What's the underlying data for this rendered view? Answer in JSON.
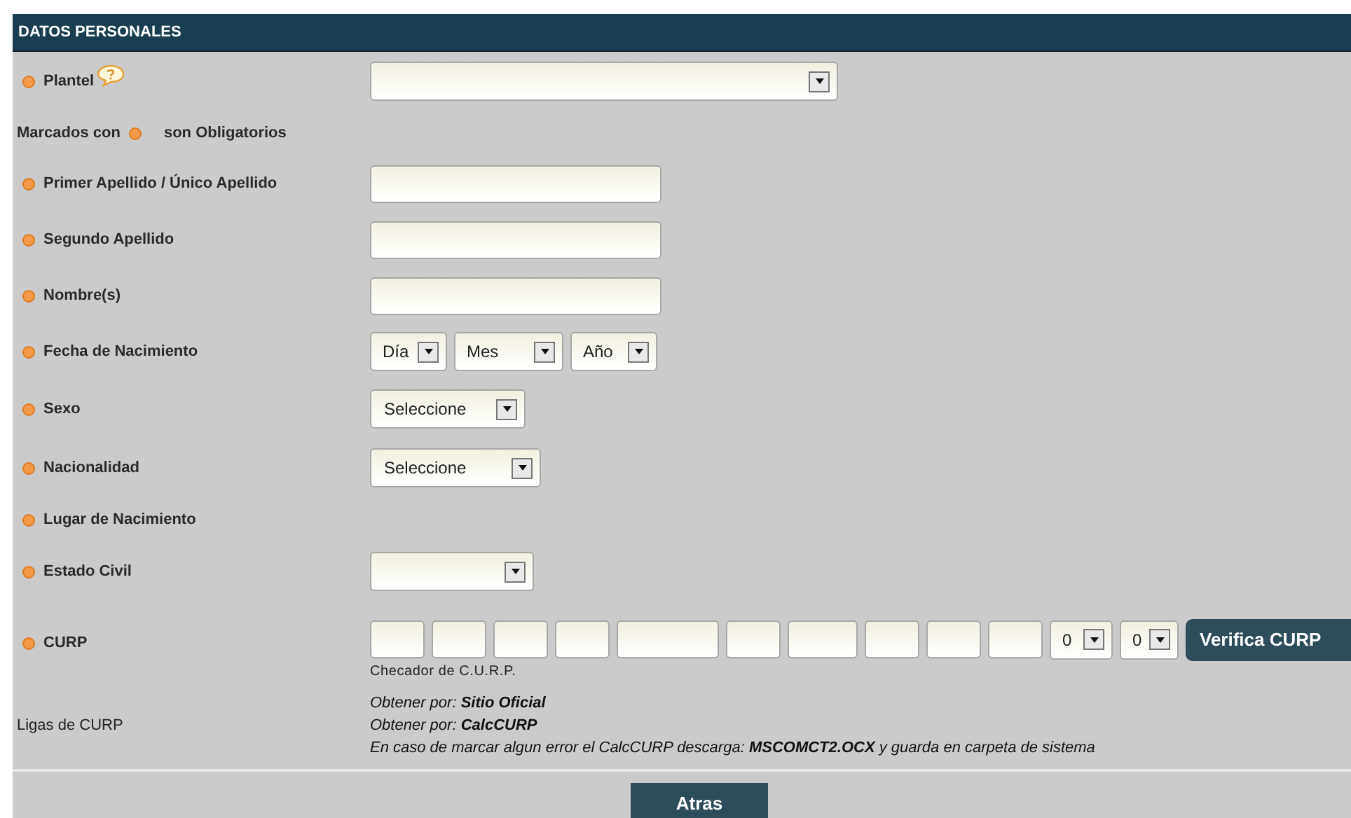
{
  "section_title": "DATOS PERSONALES",
  "rows": [
    {
      "kind": "select",
      "label": "Plantel",
      "required": true,
      "help": true,
      "value": ""
    },
    {
      "kind": "note",
      "before": "Marcados con",
      "after": "son Obligatorios"
    },
    {
      "kind": "text",
      "label": "Primer Apellido / Único Apellido",
      "required": true
    },
    {
      "kind": "text",
      "label": "Segundo Apellido",
      "required": true
    },
    {
      "kind": "text",
      "label": "Nombre(s)",
      "required": true
    },
    {
      "kind": "date",
      "label": "Fecha de Nacimiento",
      "required": true,
      "selects": [
        {
          "kind": "day",
          "value": "Día"
        },
        {
          "kind": "month",
          "value": "Mes"
        },
        {
          "kind": "year",
          "value": "Año"
        }
      ]
    },
    {
      "kind": "select",
      "label": "Sexo",
      "required": true,
      "value": "Seleccione"
    },
    {
      "kind": "select",
      "label": "Nacionalidad",
      "required": true,
      "value": "Seleccione"
    },
    {
      "kind": "none",
      "label": "Lugar de Nacimiento",
      "required": true
    },
    {
      "kind": "select",
      "label": "Estado Civil",
      "required": true,
      "value": ""
    },
    {
      "kind": "curp",
      "label": "CURP",
      "required": true,
      "caption": "Checador de C.U.R.P.",
      "button": "Verifica CURP",
      "segments": [
        {
          "kind": "short"
        },
        {
          "kind": "short"
        },
        {
          "kind": "short"
        },
        {
          "kind": "short"
        },
        {
          "kind": "wide"
        },
        {
          "kind": "short"
        },
        {
          "kind": "medium"
        },
        {
          "kind": "short"
        },
        {
          "kind": "short"
        },
        {
          "kind": "short"
        }
      ],
      "digits": [
        "0",
        "0"
      ]
    },
    {
      "kind": "links",
      "label": "Ligas de CURP",
      "lines": [
        "Obtener por: **Sitio Oficial**",
        "Obtener por: **CalcCURP**",
        "En caso de marcar algun error el CalcCURP descarga: **MSCOMCT2.OCX** y guarda en carpeta de sistema"
      ]
    }
  ],
  "footer_button": "Atras"
}
